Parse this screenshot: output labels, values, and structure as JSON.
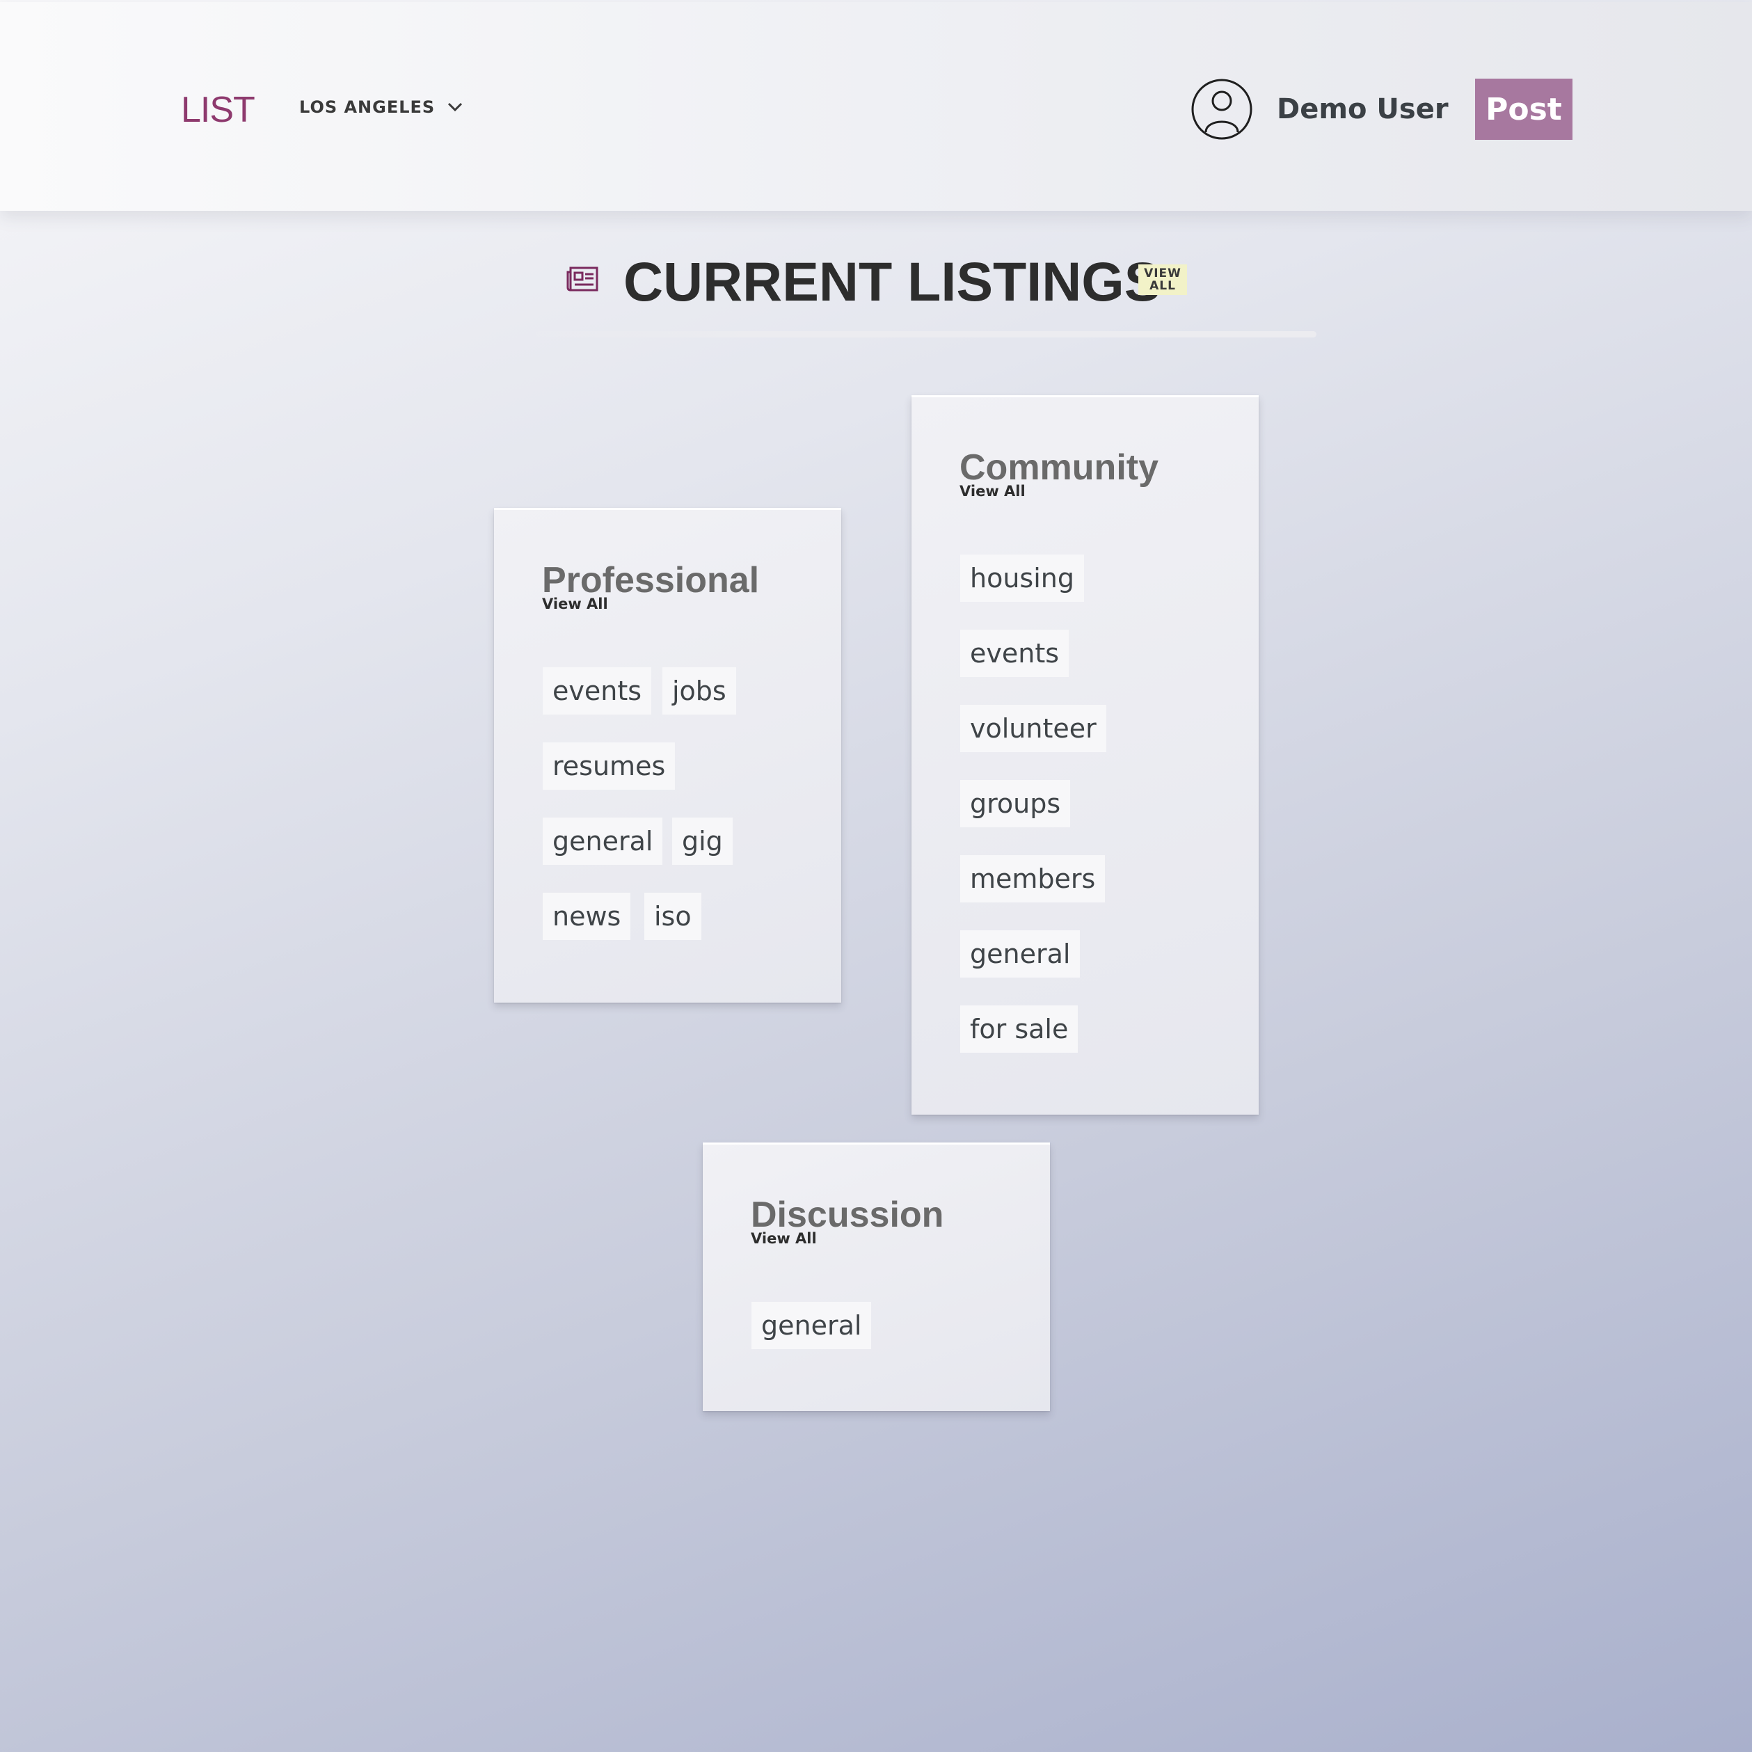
{
  "header": {
    "logo": "LIST",
    "location": "LOS ANGELES",
    "user_name": "Demo User",
    "post_label": "Post",
    "accent_color": "#8e3a6e",
    "post_color": "#a7789f"
  },
  "listings": {
    "title": "CURRENT LISTINGS",
    "view_all_line1": "VIEW",
    "view_all_line2": "ALL",
    "icon": "newspaper-icon",
    "cards": [
      {
        "title": "Professional",
        "view_all": "View All",
        "tags": [
          "events",
          "jobs",
          "resumes",
          "general",
          "gig",
          "news",
          "iso"
        ]
      },
      {
        "title": "Community",
        "view_all": "View All",
        "tags": [
          "housing",
          "events",
          "volunteer",
          "groups",
          "members",
          "general",
          "for sale"
        ]
      },
      {
        "title": "Discussion",
        "view_all": "View All",
        "tags": [
          "general"
        ]
      }
    ]
  }
}
